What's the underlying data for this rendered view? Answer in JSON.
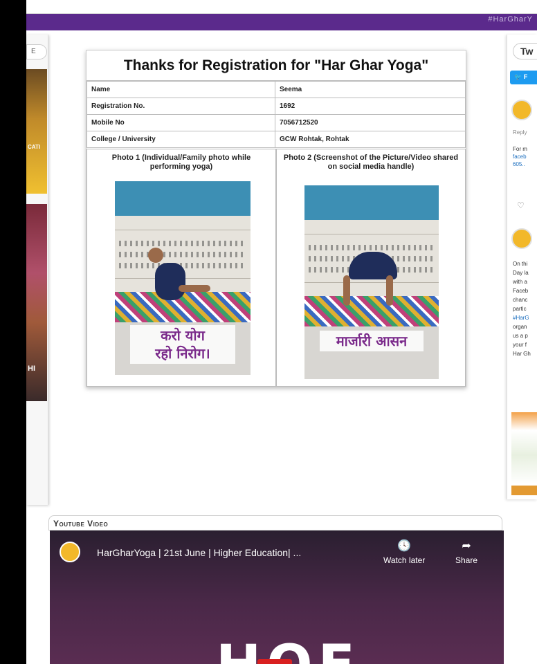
{
  "top_bar": {
    "text": "#HarGharY"
  },
  "left_column": {
    "tab_label": "E",
    "image1_text": "CATI",
    "image2_text": "HI"
  },
  "registration": {
    "title": "Thanks for Registration for \"Har Ghar Yoga\"",
    "rows": [
      {
        "key": "Name",
        "value": "Seema"
      },
      {
        "key": "Registration No.",
        "value": "1692"
      },
      {
        "key": "Mobile No",
        "value": "7056712520"
      },
      {
        "key": "College / University",
        "value": "GCW Rohtak, Rohtak"
      }
    ],
    "photo1_caption": "Photo 1 (Individual/Family photo while performing yoga)",
    "photo1_overlay_line1": "करो योग",
    "photo1_overlay_line2": "रहो निरोग।",
    "photo2_caption": "Photo 2 (Screenshot of the Picture/Video shared on social media handle)",
    "photo2_overlay": "मार्जारी आसन"
  },
  "twitter": {
    "tab_label": "Tw",
    "follow_label": "F",
    "reply_label": "Reply",
    "tweet1_line1": "For m",
    "tweet1_link1": "faceb",
    "tweet1_link2": "605..",
    "tweet2_lines": [
      "On thi",
      "Day la",
      "with a",
      "Faceb",
      "chanc",
      "partic"
    ],
    "tweet2_hashtag": "#HarG",
    "tweet2_lines_b": [
      "organ",
      "us a p",
      "your f",
      "Har Gh"
    ]
  },
  "youtube": {
    "section_title": "Youtube Video",
    "video_title": "HarGharYoga | 21st June | Higher Education| ...",
    "watch_later_label": "Watch later",
    "share_label": "Share",
    "big_text": "HOF"
  },
  "colors": {
    "purple": "#5b2a8c",
    "twitter_blue": "#1d9bf0",
    "yt_bg": "#4a2848"
  }
}
